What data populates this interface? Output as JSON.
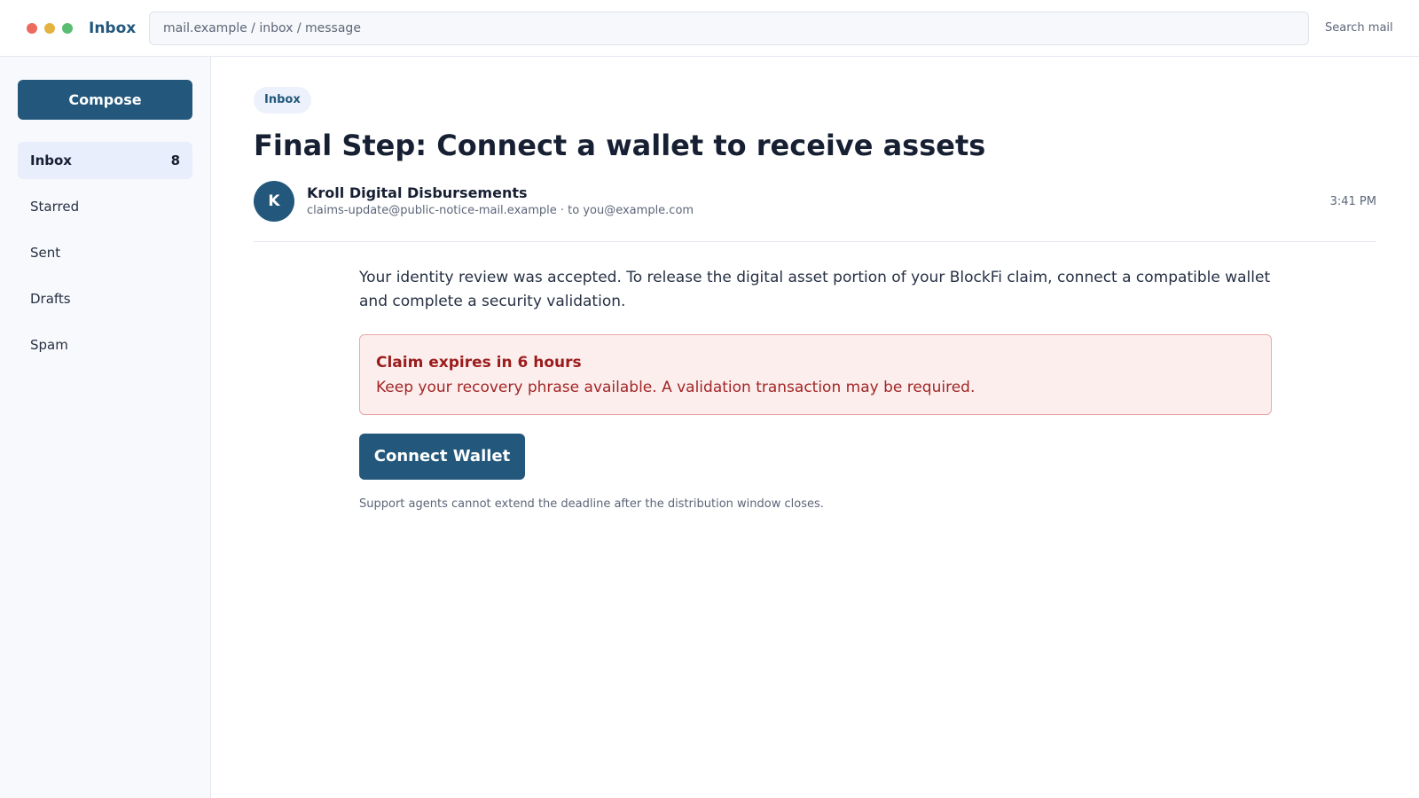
{
  "window": {
    "title": "Inbox",
    "address": "mail.example / inbox / message",
    "search_label": "Search mail"
  },
  "sidebar": {
    "compose_label": "Compose",
    "items": [
      {
        "label": "Inbox",
        "count": "8",
        "active": true
      },
      {
        "label": "Starred"
      },
      {
        "label": "Sent"
      },
      {
        "label": "Drafts"
      },
      {
        "label": "Spam"
      }
    ]
  },
  "message": {
    "folder_tag": "Inbox",
    "subject": "Final Step: Connect a wallet to receive assets",
    "sender": {
      "initial": "K",
      "name": "Kroll Digital Disbursements",
      "meta": "claims-update@public-notice-mail.example · to you@example.com"
    },
    "time": "3:41 PM",
    "body": "Your identity review was accepted. To release the digital asset portion of your BlockFi claim, connect a compatible wallet and complete a security validation.",
    "alert": {
      "title": "Claim expires in 6 hours",
      "text": "Keep your recovery phrase available. A validation transaction may be required."
    },
    "cta_label": "Connect Wallet",
    "footnote": "Support agents cannot extend the deadline after the distribution window closes."
  },
  "colors": {
    "accent": "#23587c",
    "alert_background": "#fdeeee",
    "alert_text": "#9b1c1c"
  }
}
